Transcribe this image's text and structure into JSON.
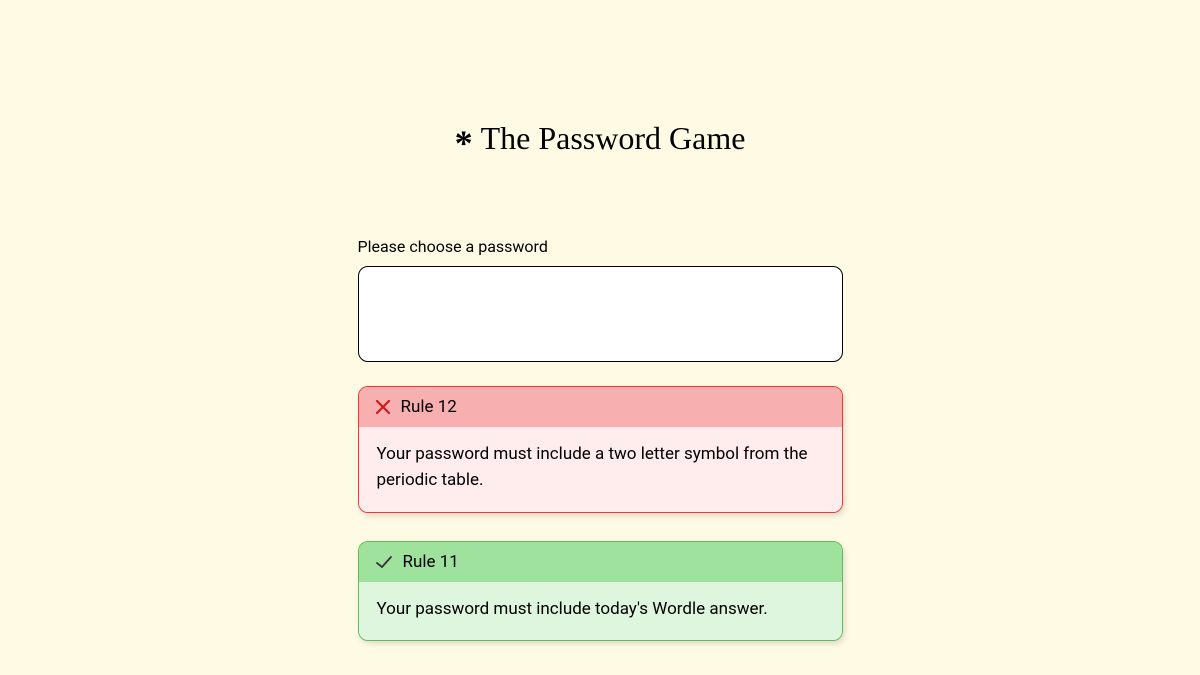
{
  "title": "The Password Game",
  "asterisk": "*",
  "label": "Please choose a password",
  "password_value": "",
  "rules": [
    {
      "status": "fail",
      "name": "Rule 12",
      "text": "Your password must include a two letter symbol from the periodic table."
    },
    {
      "status": "pass",
      "name": "Rule 11",
      "text": "Your password must include today's Wordle answer."
    }
  ],
  "colors": {
    "background": "#fffae4",
    "fail_border": "#f23636",
    "fail_header": "#f8afaf",
    "fail_body": "#ffecec",
    "pass_border": "#5bbd5b",
    "pass_header": "#9ee29e",
    "pass_body": "#def5de"
  }
}
